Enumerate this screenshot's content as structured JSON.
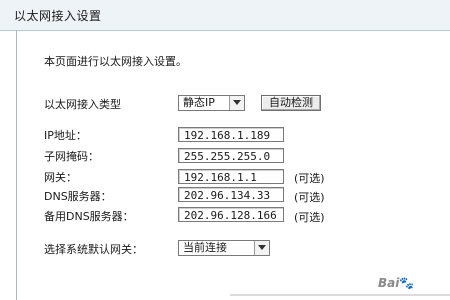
{
  "header": {
    "title": "以太网接入设置"
  },
  "description": "本页面进行以太网接入设置。",
  "connection_type": {
    "label": "以太网接入类型",
    "value": "静态IP",
    "detect_button": "自动检测"
  },
  "fields": [
    {
      "label": "IP地址：",
      "value": "192.168.1.189",
      "note": ""
    },
    {
      "label": "子网掩码：",
      "value": "255.255.255.0",
      "note": ""
    },
    {
      "label": "网关：",
      "value": "192.168.1.1",
      "note": "(可选)"
    },
    {
      "label": "DNS服务器：",
      "value": "202.96.134.33",
      "note": "(可选)"
    },
    {
      "label": "备用DNS服务器：",
      "value": "202.96.128.166",
      "note": "(可选)"
    }
  ],
  "gateway_select": {
    "label": "选择系统默认网关：",
    "value": "当前连接"
  },
  "watermark": {
    "text": "Bai",
    "icon": "baidu-paw-icon"
  }
}
